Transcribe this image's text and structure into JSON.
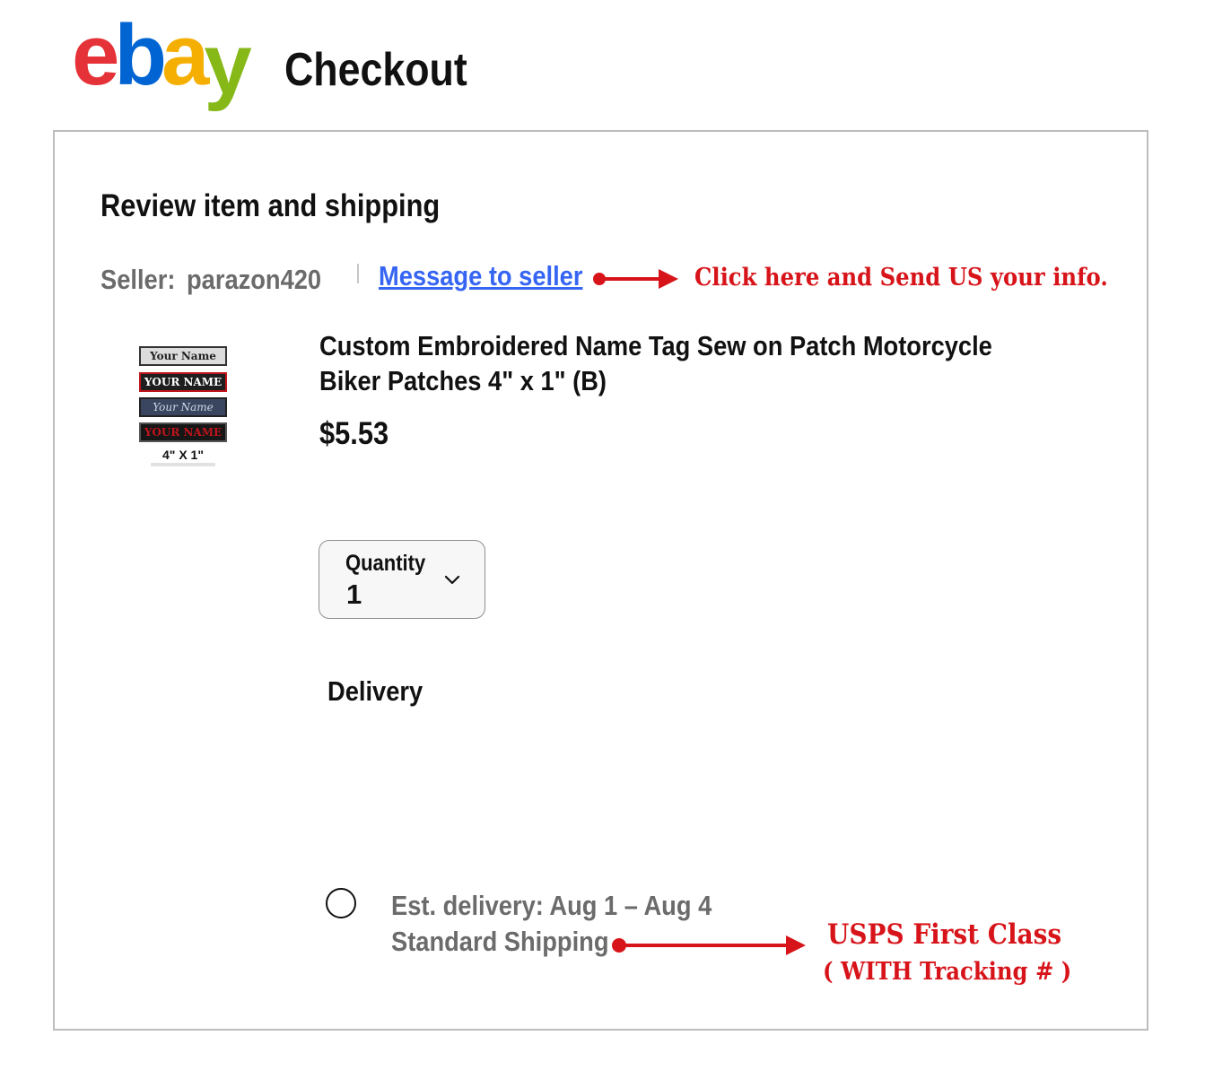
{
  "header": {
    "logo": {
      "letters": [
        "e",
        "b",
        "a",
        "y"
      ],
      "colors": [
        "#e53238",
        "#0064d2",
        "#f5af02",
        "#86b817"
      ]
    },
    "title": "Checkout"
  },
  "review": {
    "heading": "Review item and shipping",
    "seller_label": "Seller:",
    "seller_name": "parazon420",
    "message_link": "Message to seller",
    "annotation": "Click here and Send US your info."
  },
  "item": {
    "thumbnail": {
      "tags": [
        "Your Name",
        "YOUR NAME",
        "Your Name",
        "YOUR NAME"
      ],
      "size_label": "4\" X 1\""
    },
    "title": "Custom Embroidered Name Tag Sew on Patch Motorcycle Biker Patches 4\" x 1\" (B)",
    "price": "$5.53"
  },
  "quantity": {
    "label": "Quantity",
    "value": "1"
  },
  "delivery": {
    "heading": "Delivery",
    "option": {
      "selected": false,
      "estimate": "Est. delivery: Aug 1 – Aug 4",
      "method": "Standard Shipping"
    },
    "annotation_line1": "USPS First Class",
    "annotation_line2": "( WITH Tracking # )"
  },
  "colors": {
    "link": "#3665f3",
    "annotation": "#d7141a",
    "muted_text": "#6b6b6b"
  },
  "icons": {
    "quantity_dropdown": "chevron-down-icon",
    "annotation_arrow": "arrow-right-icon"
  }
}
